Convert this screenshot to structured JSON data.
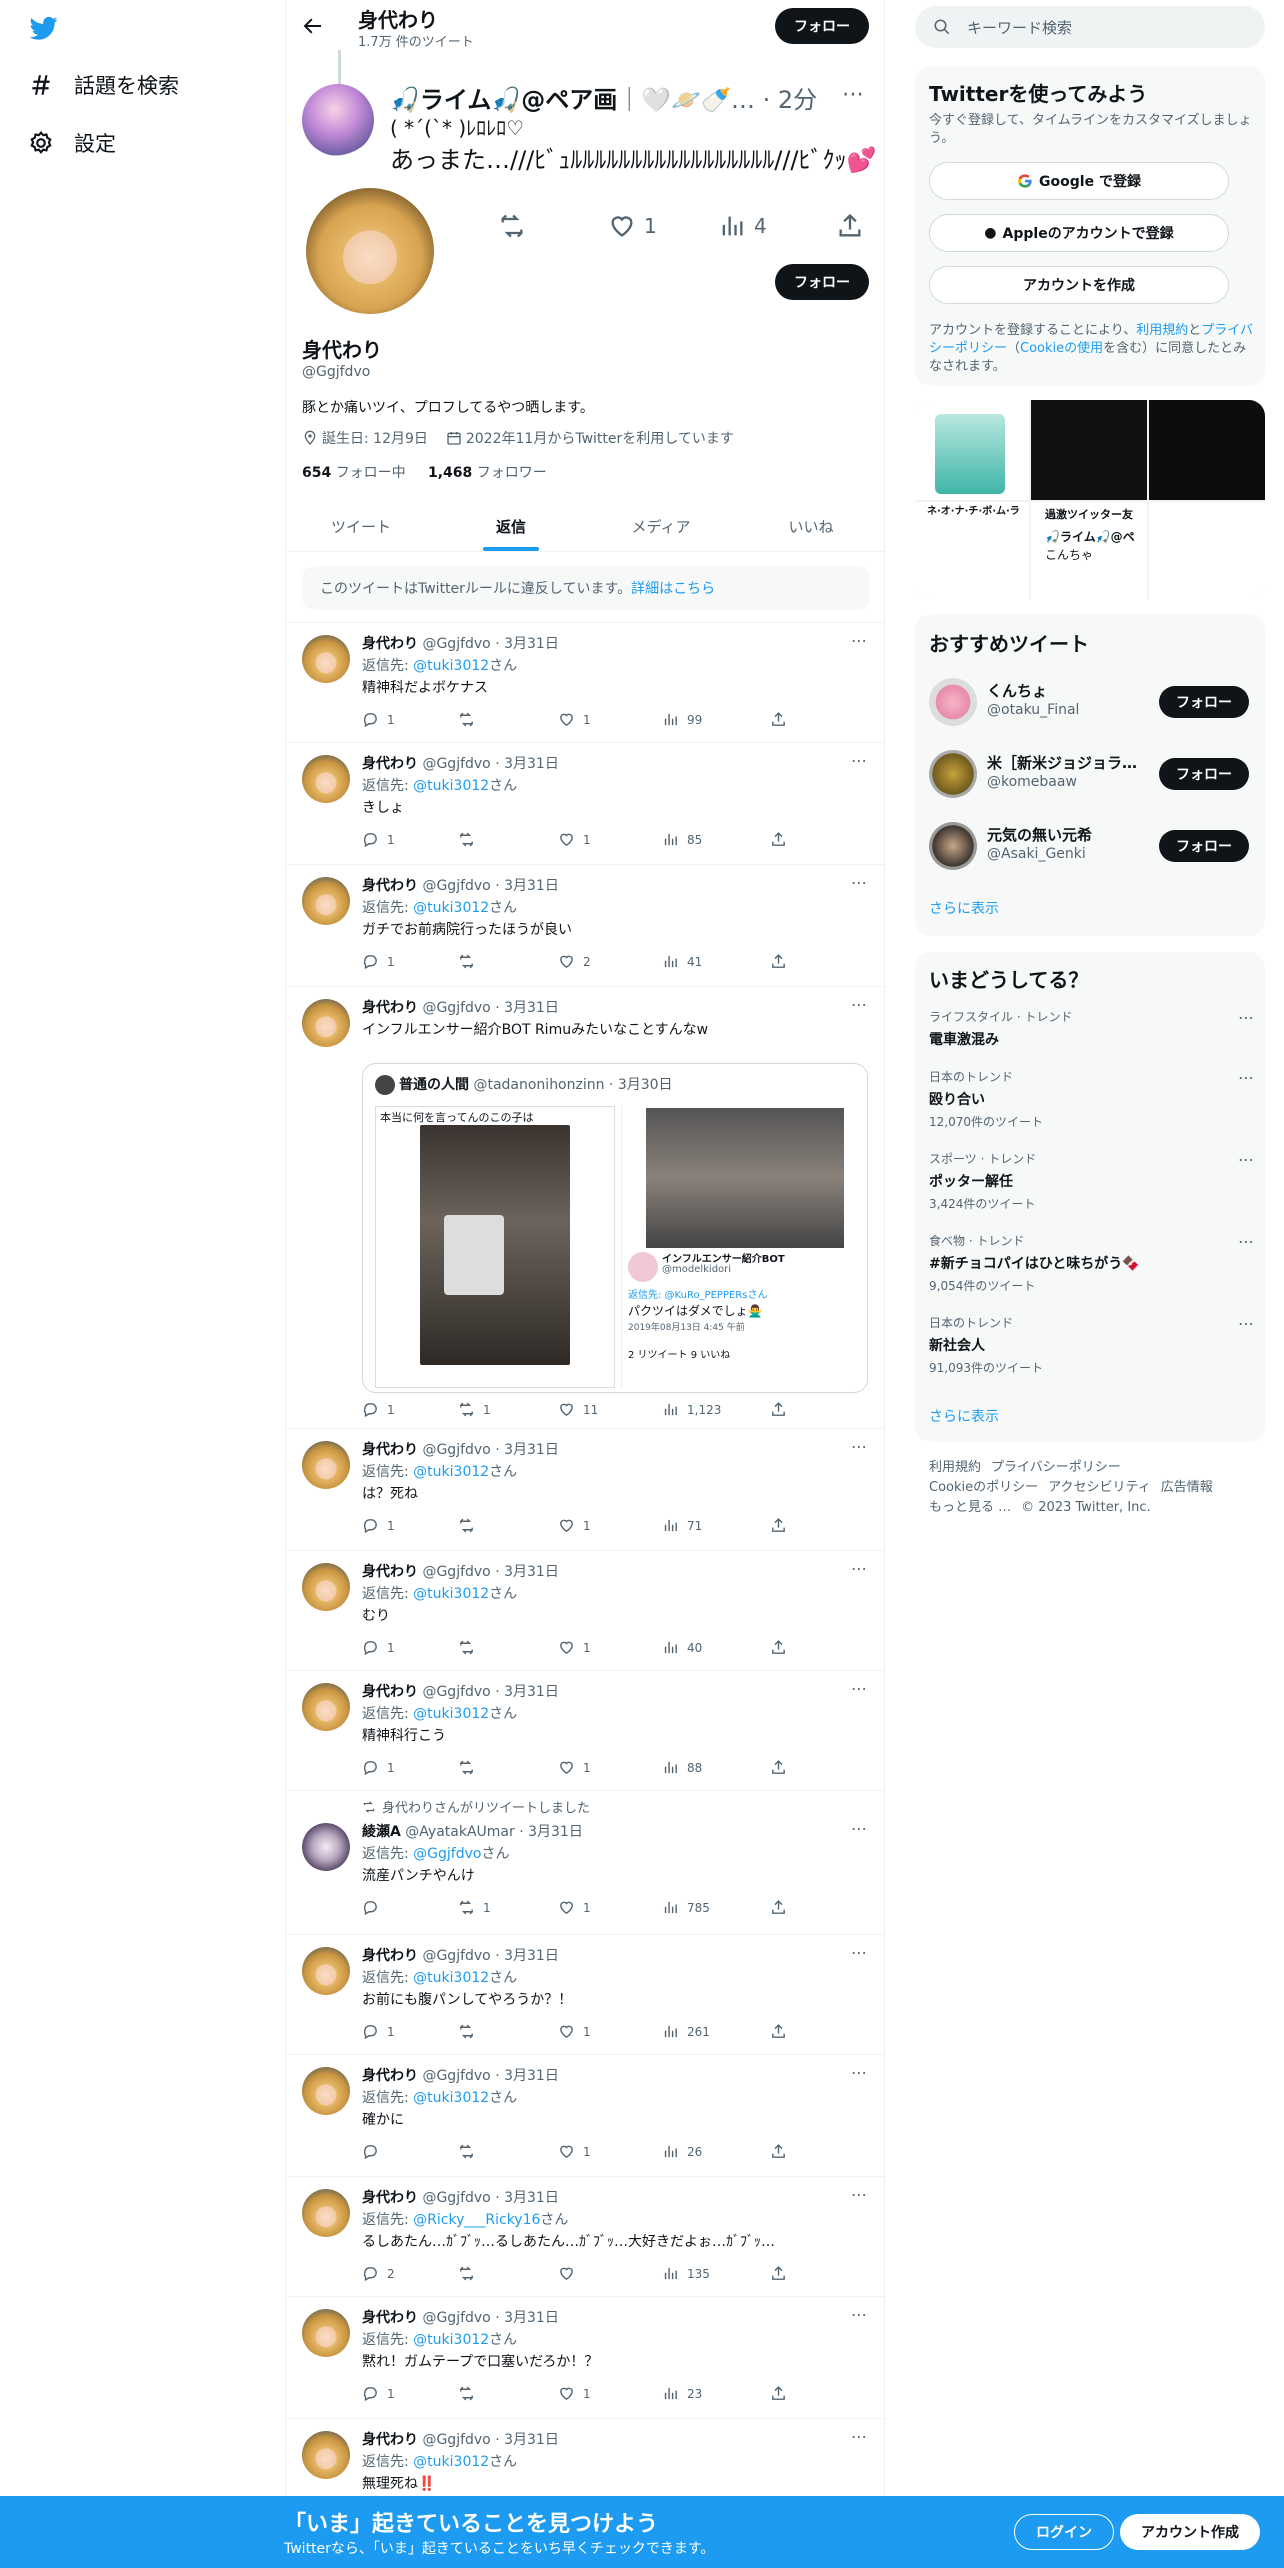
{
  "nav": {
    "explore": "話題を検索",
    "settings": "設定"
  },
  "header": {
    "name": "身代わり",
    "tweet_count": "1.7万 件のツイート",
    "follow": "フォロー"
  },
  "pinned": {
    "title": "🎣ライム🎣@ペア画",
    "title_tail": "｜🤍🪐🍼… · 2分",
    "line2": "( *´(`* )ﾚﾛﾚﾛ♡",
    "line3": "あっまた…///ﾋﾞｭﾙﾙﾙﾙﾙﾙﾙﾙﾙﾙﾙﾙﾙﾙﾙﾙﾙ///ﾋﾞｸｯ💕",
    "likes": "1",
    "views": "4"
  },
  "profile": {
    "follow": "フォロー",
    "name": "身代わり",
    "handle": "@Ggjfdvo",
    "bio": "豚とか痛いツイ、プロフしてるやつ晒します。",
    "birthday": "誕生日: 12月9日",
    "joined": "2022年11月からTwitterを利用しています",
    "following_count": "654",
    "following_label": "フォロー中",
    "followers_count": "1,468",
    "followers_label": "フォロワー"
  },
  "tabs": [
    "ツイート",
    "返信",
    "メディア",
    "いいね"
  ],
  "notice": {
    "text": "このツイートはTwitterルールに違反しています。",
    "link": "詳細はこちら"
  },
  "tweets": [
    {
      "name": "身代わり",
      "meta": "@Ggjfdvo · 3月31日",
      "reply_prefix": "返信先: ",
      "reply_to": "@tuki3012",
      "reply_suffix": "さん",
      "text": "精神科だよボケナス",
      "replies": "1",
      "retweets": "",
      "likes": "1",
      "views": "99"
    },
    {
      "name": "身代わり",
      "meta": "@Ggjfdvo · 3月31日",
      "reply_prefix": "返信先: ",
      "reply_to": "@tuki3012",
      "reply_suffix": "さん",
      "text": "きしょ",
      "replies": "1",
      "retweets": "",
      "likes": "1",
      "views": "85"
    },
    {
      "name": "身代わり",
      "meta": "@Ggjfdvo · 3月31日",
      "reply_prefix": "返信先: ",
      "reply_to": "@tuki3012",
      "reply_suffix": "さん",
      "text": "ガチでお前病院行ったほうが良い",
      "replies": "1",
      "retweets": "",
      "likes": "2",
      "views": "41"
    },
    {
      "name": "身代わり",
      "meta": "@Ggjfdvo · 3月31日",
      "text": "インフルエンサー紹介BOT Rimuみたいなことすんなw",
      "replies": "1",
      "retweets": "1",
      "likes": "11",
      "views": "1,123",
      "quote": {
        "name": "普通の人間",
        "meta": "@tadanonihonzinn · 3月30日",
        "img1_caption": "本当に何を言ってんのこの子は",
        "img2_name": "インフルエンサー紹介BOT",
        "img2_handle": "@modelkidori",
        "img2_reply": "返信先: @KuRo_PEPPERsさん",
        "img2_text": "パクツイはダメでしょ🙅‍♂️",
        "img2_date": "2019年08月13日 4:45 午前",
        "img2_stats": "2 リツイート  9 いいね"
      }
    },
    {
      "name": "身代わり",
      "meta": "@Ggjfdvo · 3月31日",
      "reply_prefix": "返信先: ",
      "reply_to": "@tuki3012",
      "reply_suffix": "さん",
      "text": "は？死ね",
      "replies": "1",
      "retweets": "",
      "likes": "1",
      "views": "71"
    },
    {
      "name": "身代わり",
      "meta": "@Ggjfdvo · 3月31日",
      "reply_prefix": "返信先: ",
      "reply_to": "@tuki3012",
      "reply_suffix": "さん",
      "text": "むり",
      "replies": "1",
      "retweets": "",
      "likes": "1",
      "views": "40"
    },
    {
      "name": "身代わり",
      "meta": "@Ggjfdvo · 3月31日",
      "reply_prefix": "返信先: ",
      "reply_to": "@tuki3012",
      "reply_suffix": "さん",
      "text": "精神科行こう",
      "replies": "1",
      "retweets": "",
      "likes": "1",
      "views": "88"
    },
    {
      "retweet_label": "身代わりさんがリツイートしました",
      "name": "綾瀬A",
      "meta": "@AyatakAUmar · 3月31日",
      "reply_prefix": "返信先: ",
      "reply_to": "@Ggjfdvo",
      "reply_suffix": "さん",
      "text": "流産パンチやんけ",
      "replies": "",
      "retweets": "1",
      "likes": "1",
      "views": "785"
    },
    {
      "name": "身代わり",
      "meta": "@Ggjfdvo · 3月31日",
      "reply_prefix": "返信先: ",
      "reply_to": "@tuki3012",
      "reply_suffix": "さん",
      "text": "お前にも腹パンしてやろうか？！",
      "replies": "1",
      "retweets": "",
      "likes": "1",
      "views": "261"
    },
    {
      "name": "身代わり",
      "meta": "@Ggjfdvo · 3月31日",
      "reply_prefix": "返信先: ",
      "reply_to": "@tuki3012",
      "reply_suffix": "さん",
      "text": "確かに",
      "replies": "",
      "retweets": "",
      "likes": "1",
      "views": "26"
    },
    {
      "name": "身代わり",
      "meta": "@Ggjfdvo · 3月31日",
      "reply_prefix": "返信先: ",
      "reply_to": "@Ricky___Ricky16",
      "reply_suffix": "さん",
      "text": "るしあたん…ｶﾞﾌﾞｯ…るしあたん…ｶﾞﾌﾞｯ…大好きだよぉ…ｶﾞﾌﾞｯ…",
      "replies": "2",
      "retweets": "",
      "likes": "",
      "views": "135"
    },
    {
      "name": "身代わり",
      "meta": "@Ggjfdvo · 3月31日",
      "reply_prefix": "返信先: ",
      "reply_to": "@tuki3012",
      "reply_suffix": "さん",
      "text": "黙れ！ガムテープで口塞いだろか！？",
      "replies": "1",
      "retweets": "",
      "likes": "1",
      "views": "23"
    },
    {
      "name": "身代わり",
      "meta": "@Ggjfdvo · 3月31日",
      "reply_prefix": "返信先: ",
      "reply_to": "@tuki3012",
      "reply_suffix": "さん",
      "text": "無理死ね‼️",
      "replies": "",
      "retweets": "",
      "likes": "",
      "views": ""
    }
  ],
  "right": {
    "search_placeholder": "キーワード検索",
    "signup": {
      "title": "Twitterを使ってみよう",
      "sub": "今すぐ登録して、タイムラインをカスタマイズしましょう。",
      "google": "Google で登録",
      "apple": "Appleのアカウントで登録",
      "create": "アカウントを作成",
      "terms1": "アカウントを登録することにより、",
      "terms_link1": "利用規約",
      "terms2": "と",
      "terms_link2": "プライバシーポリシー",
      "terms3": "（",
      "terms_link3": "Cookieの使用",
      "terms4": "を含む）に同意したとみなされます。"
    },
    "media_labels": {
      "m1": "ネ·オ·ナ·チ·ボ·ム·ラ",
      "m2": "過激ツイッター友",
      "m3": "こんちゃ",
      "m4": "🎣ライム🎣@ペ"
    },
    "rec": {
      "title": "おすすめツイート",
      "follow": "フォロー",
      "more": "さらに表示",
      "users": [
        {
          "name": "くんちょ",
          "handle": "@otaku_Final"
        },
        {
          "name": "米［新米ジョジョラ…",
          "handle": "@komebaaw"
        },
        {
          "name": "元気の無い元希",
          "handle": "@Asaki_Genki"
        }
      ]
    },
    "trends": {
      "title": "いまどうしてる？",
      "more": "さらに表示",
      "items": [
        {
          "cat": "ライフスタイル · トレンド",
          "name": "電車激混み",
          "count": ""
        },
        {
          "cat": "日本のトレンド",
          "name": "殴り合い",
          "count": "12,070件のツイート"
        },
        {
          "cat": "スポーツ · トレンド",
          "name": "ポッター解任",
          "count": "3,424件のツイート"
        },
        {
          "cat": "食べ物 · トレンド",
          "name": "#新チョコパイはひと味ちがう🍫",
          "count": "9,054件のツイート"
        },
        {
          "cat": "日本のトレンド",
          "name": "新社会人",
          "count": "91,093件のツイート"
        }
      ]
    },
    "footer": {
      "l1": "利用規約",
      "l2": "プライバシーポリシー",
      "l3": "Cookieのポリシー",
      "l4": "アクセシビリティ",
      "l5": "広告情報",
      "l6": "もっと見る …",
      "l7": "© 2023 Twitter, Inc."
    }
  },
  "banner": {
    "title": "「いま」起きていることを見つけよう",
    "sub": "Twitterなら、「いま」起きていることをいち早くチェックできます。",
    "login": "ログイン",
    "signup": "アカウント作成"
  },
  "colors": {
    "accent": "#1d9bf0",
    "text": "#0f1419",
    "muted": "#536471"
  }
}
